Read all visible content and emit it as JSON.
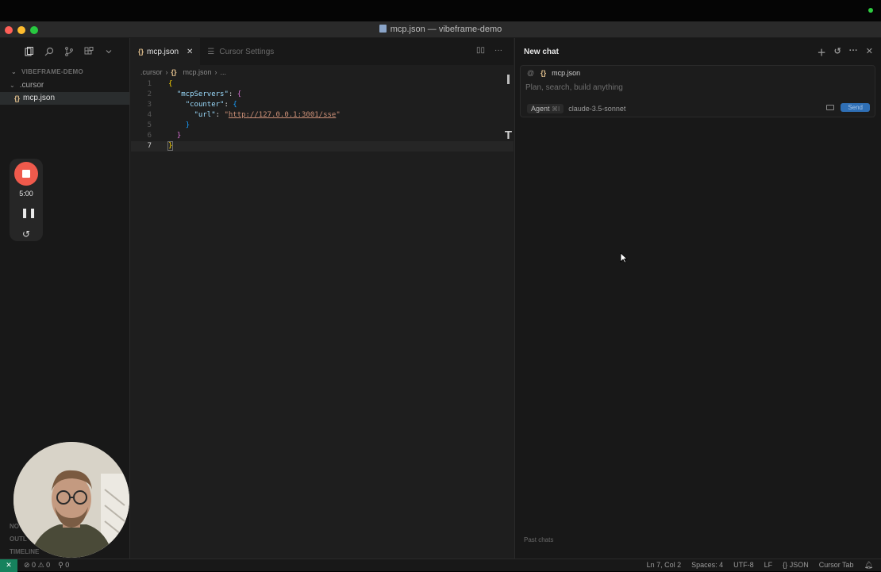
{
  "window": {
    "title": "mcp.json — vibeframe-demo"
  },
  "sidebar": {
    "section_title": "VIBEFRAME-DEMO",
    "tree": [
      {
        "label": ".cursor",
        "kind": "folder"
      },
      {
        "label": "mcp.json",
        "kind": "file"
      }
    ],
    "bottom_sections": [
      "NO",
      "OUTL",
      "TIMELINE"
    ]
  },
  "recorder": {
    "time": "5:00"
  },
  "editor": {
    "tabs": [
      {
        "label": "mcp.json",
        "active": true
      },
      {
        "label": "Cursor Settings",
        "active": false
      }
    ],
    "breadcrumb": [
      ".cursor",
      "mcp.json",
      "..."
    ],
    "lines": [
      {
        "n": "1"
      },
      {
        "n": "2"
      },
      {
        "n": "3"
      },
      {
        "n": "4"
      },
      {
        "n": "5"
      },
      {
        "n": "6"
      },
      {
        "n": "7"
      }
    ],
    "code": {
      "key_mcp": "\"mcpServers\"",
      "key_counter": "\"counter\"",
      "key_url": "\"url\"",
      "url_value": "http://127.0.0.1:3001/sse"
    }
  },
  "chat": {
    "header": "New chat",
    "context_file": "mcp.json",
    "placeholder": "Plan, search, build anything",
    "mode": "Agent",
    "mode_shortcut": "⌘I",
    "model": "claude-3.5-sonnet",
    "send_label": "Send",
    "past_chats": "Past chats"
  },
  "statusbar": {
    "errors": "0",
    "warnings": "0",
    "ports": "0",
    "position": "Ln 7, Col 2",
    "spaces": "Spaces: 4",
    "encoding": "UTF-8",
    "eol": "LF",
    "language": "JSON",
    "cursor_tab": "Cursor Tab"
  }
}
